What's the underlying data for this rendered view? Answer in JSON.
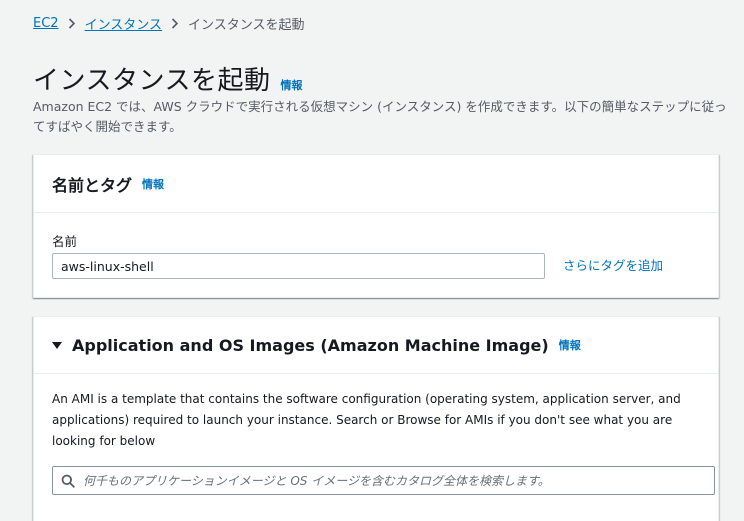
{
  "breadcrumb": {
    "items": [
      {
        "label": "EC2"
      },
      {
        "label": "インスタンス"
      }
    ],
    "current": "インスタンスを起動"
  },
  "page": {
    "title": "インスタンスを起動",
    "info_label": "情報",
    "description": "Amazon EC2 では、AWS クラウドで実行される仮想マシン (インスタンス) を作成できます。以下の簡単なステップに従ってすばやく開始できます。"
  },
  "name_panel": {
    "title": "名前とタグ",
    "info_label": "情報",
    "field_label": "名前",
    "name_value": "aws-linux-shell",
    "add_tags_label": "さらにタグを追加"
  },
  "ami_panel": {
    "title": "Application and OS Images (Amazon Machine Image)",
    "info_label": "情報",
    "description": "An AMI is a template that contains the software configuration (operating system, application server, and applications) required to launch your instance. Search or Browse for AMIs if you don't see what you are looking for below",
    "search_placeholder": "何千ものアプリケーションイメージと OS イメージを含むカタログ全体を検索します。",
    "expanded": true
  },
  "icons": {
    "breadcrumb_separator": "chevron-right-icon",
    "collapse": "caret-down-icon",
    "search": "search-icon"
  },
  "colors": {
    "link": "#0073bb",
    "background": "#f2f3f3",
    "panel": "#ffffff",
    "text": "#16191f",
    "secondary_text": "#545b64"
  }
}
